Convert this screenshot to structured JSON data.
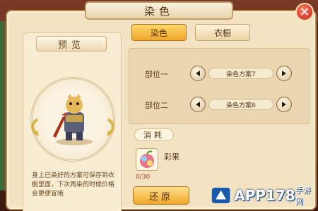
{
  "window": {
    "title": "染色",
    "close_label": "✕"
  },
  "preview": {
    "title": "预览",
    "hint": "身上已染好的方案可保存到衣橱里面，下次再染的时候价格会更便宜哦"
  },
  "tabs": [
    {
      "label": "染色",
      "active": true
    },
    {
      "label": "衣橱",
      "active": false
    }
  ],
  "parts": [
    {
      "label": "部位一",
      "value": "染色方案7"
    },
    {
      "label": "部位二",
      "value": "染色方案6"
    }
  ],
  "consume": {
    "label": "消耗",
    "item_name": "彩果",
    "count": "0/30"
  },
  "actions": {
    "restore_label": "还原"
  },
  "watermark": {
    "text": "APP178",
    "sub": "手游网"
  },
  "colors": {
    "panel_bg": "#f3e3c2",
    "accent_gold": "#f0a72a",
    "close_red": "#c0201a",
    "count_red": "#b03a2a"
  }
}
